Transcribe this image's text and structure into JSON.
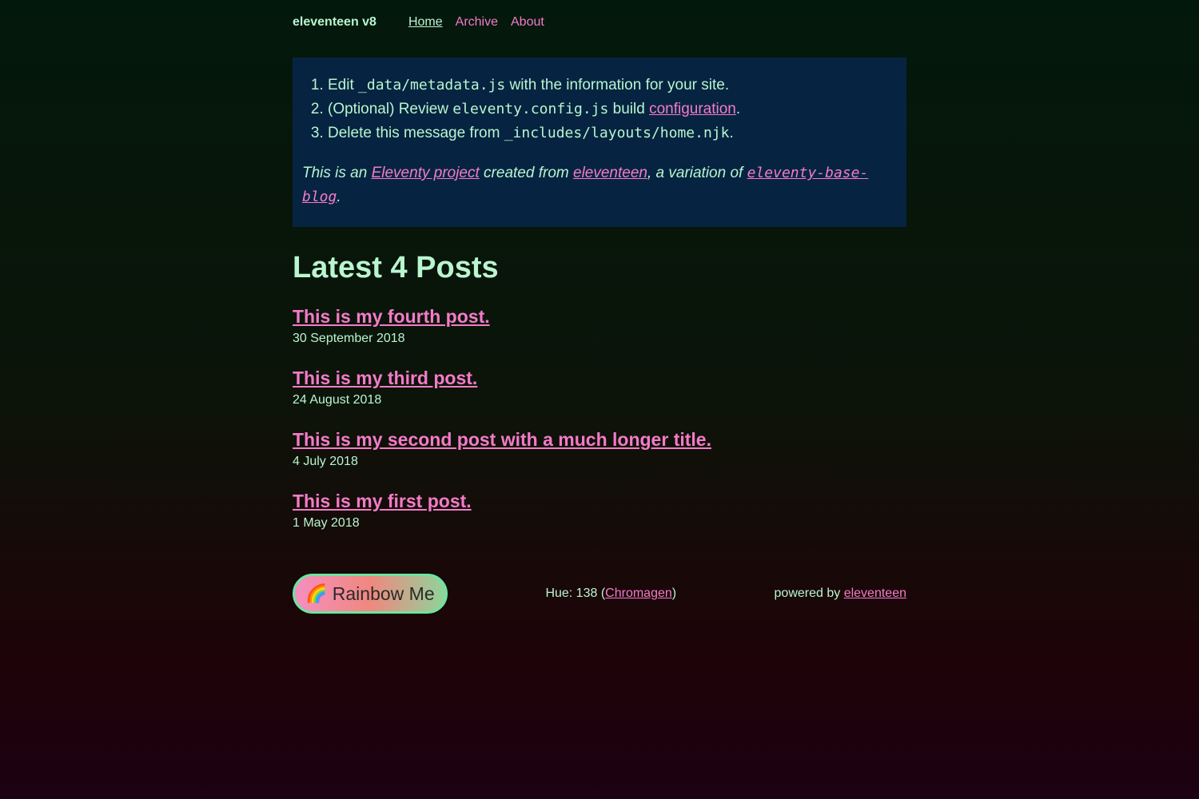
{
  "header": {
    "site_title": "eleventeen v8",
    "nav": [
      {
        "label": "Home"
      },
      {
        "label": "Archive"
      },
      {
        "label": "About"
      }
    ]
  },
  "message": {
    "steps": [
      {
        "pre": "Edit ",
        "code": "_data/metadata.js",
        "post": " with the information for your site."
      },
      {
        "pre": "(Optional) Review ",
        "code": "eleventy.config.js",
        "mid": " build ",
        "link": "configuration",
        "post": "."
      },
      {
        "pre": "Delete this message from ",
        "code": "_includes/layouts/home.njk",
        "post": "."
      }
    ],
    "note": {
      "t1": "This is an ",
      "link1": "Eleventy project",
      "t2": " created from ",
      "link2": "eleventeen",
      "t3": ", a variation of ",
      "link3": "eleventy-base-blog",
      "t4": "."
    }
  },
  "main": {
    "heading": "Latest 4 Posts",
    "posts": [
      {
        "title": "This is my fourth post.",
        "date": "30 September 2018"
      },
      {
        "title": "This is my third post.",
        "date": "24 August 2018"
      },
      {
        "title": "This is my second post with a much longer title.",
        "date": "4 July 2018"
      },
      {
        "title": "This is my first post.",
        "date": "1 May 2018"
      }
    ]
  },
  "footer": {
    "rainbow_icon": "rainbow-icon",
    "rainbow_glyph": "🌈",
    "rainbow_label": "Rainbow Me",
    "hue_prefix": "Hue: 138 (",
    "hue_link": "Chromagen",
    "hue_suffix": ")",
    "powered_prefix": "powered by ",
    "powered_link": "eleventeen"
  },
  "colors": {
    "text": "#b9f5cf",
    "link": "#f47bc8",
    "message_bg": "#062441"
  }
}
